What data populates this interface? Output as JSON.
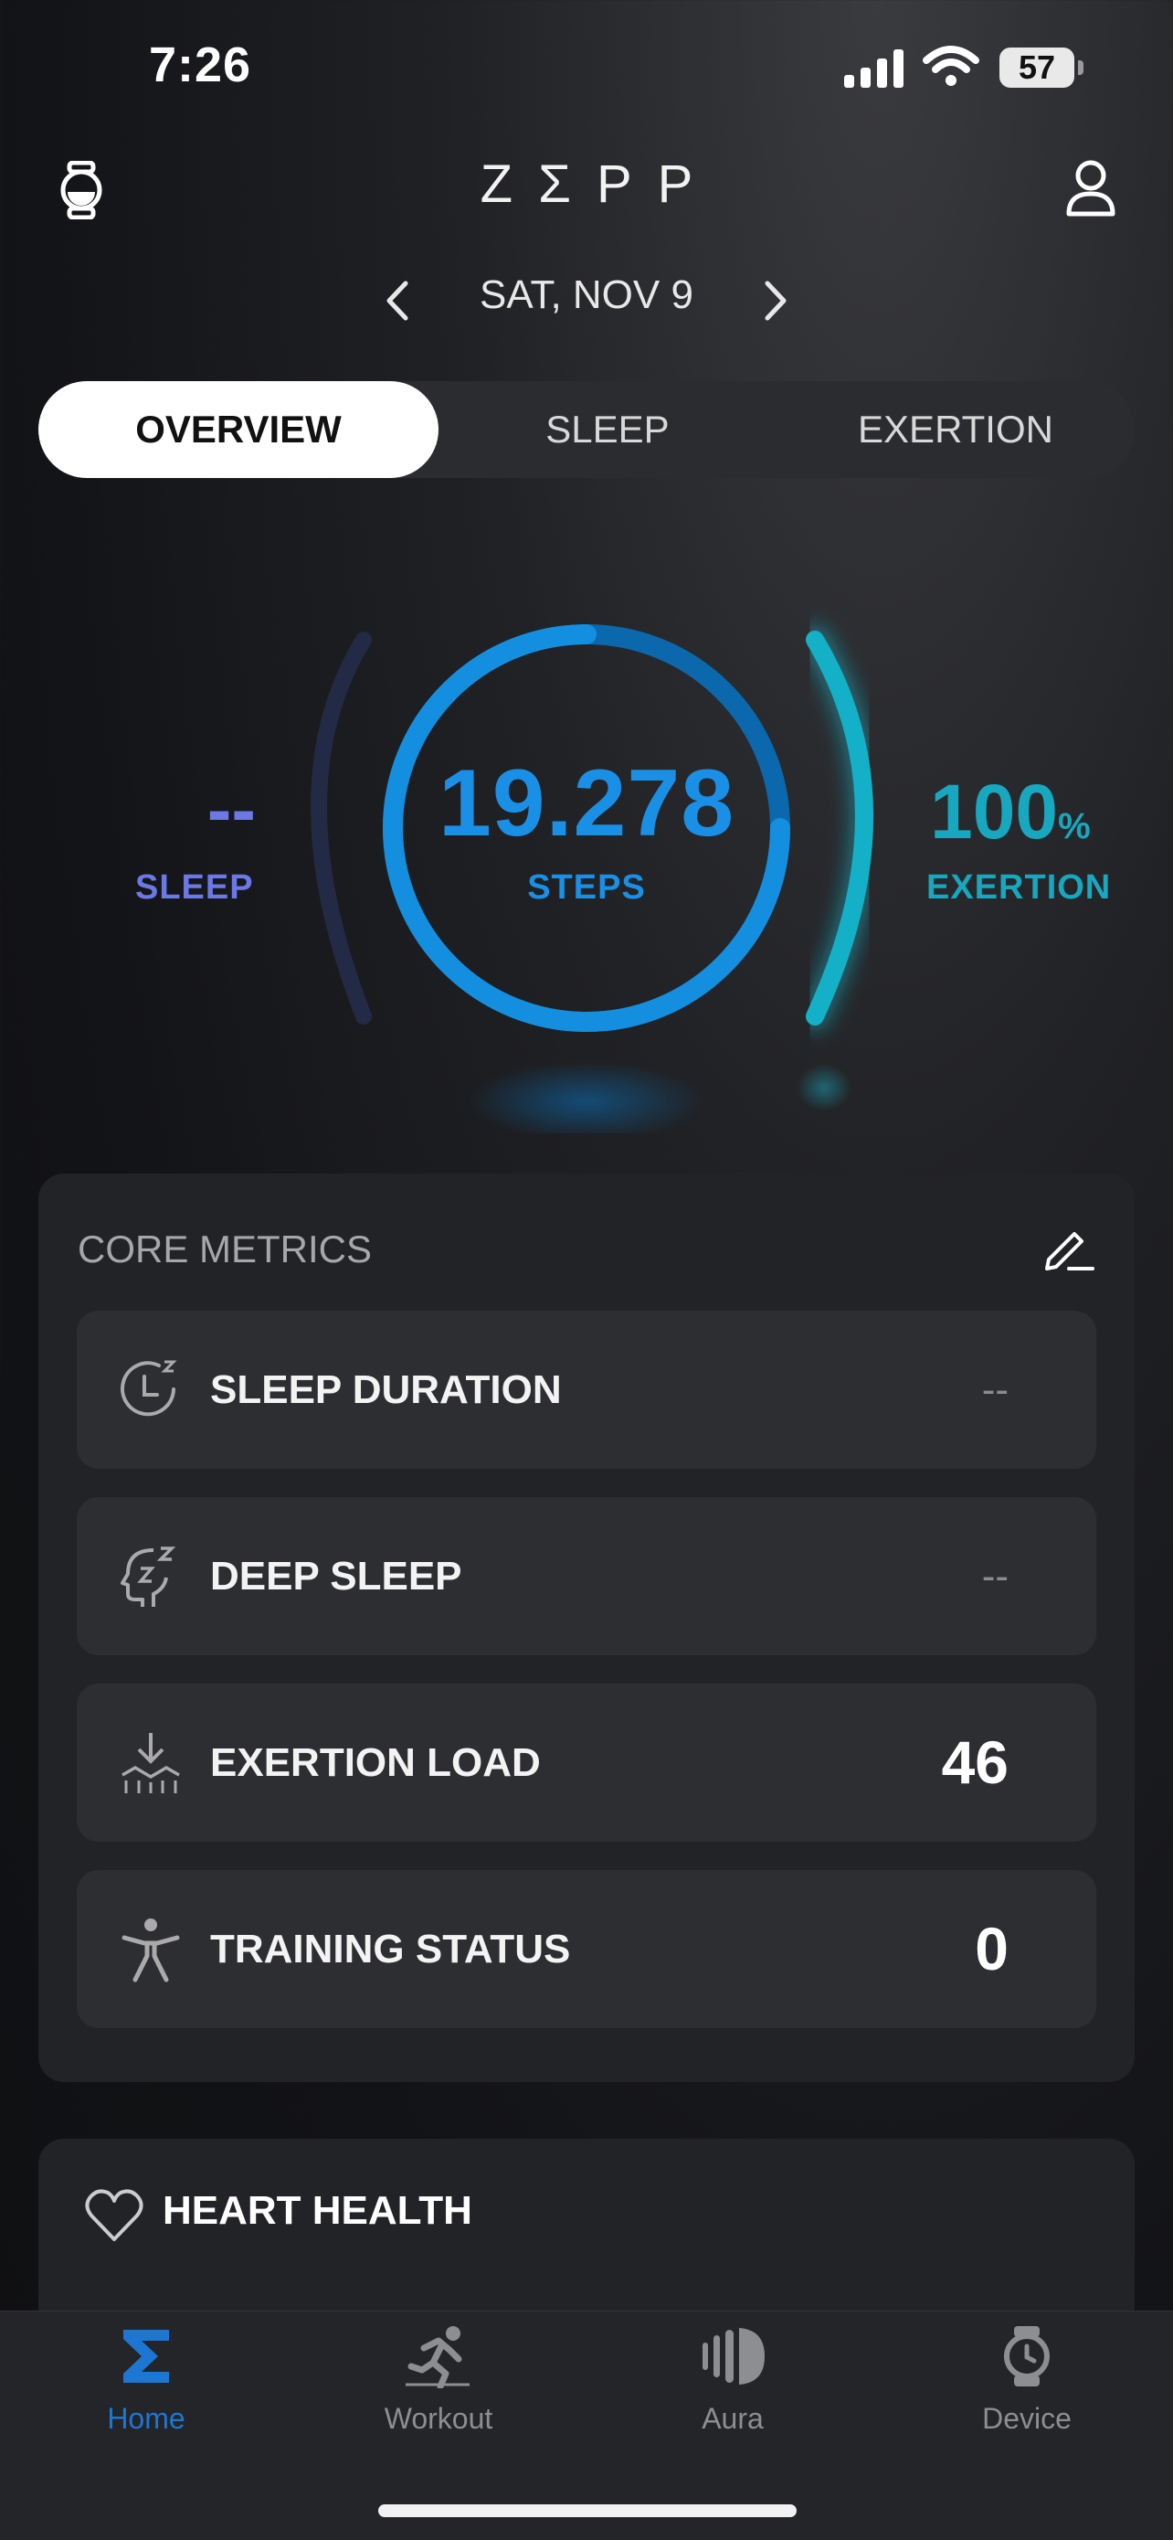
{
  "status_bar": {
    "time": "7:26",
    "battery": "57"
  },
  "header": {
    "brand": "ZΣPP",
    "date": "SAT, NOV 9"
  },
  "tabs": [
    {
      "label": "OVERVIEW",
      "active": true
    },
    {
      "label": "SLEEP",
      "active": false
    },
    {
      "label": "EXERTION",
      "active": false
    }
  ],
  "summary": {
    "sleep": {
      "value": "--",
      "label": "SLEEP"
    },
    "steps": {
      "value": "19.278",
      "label": "STEPS"
    },
    "exertion": {
      "value": "100",
      "unit": "%",
      "label": "EXERTION",
      "level": 1.0
    }
  },
  "core_metrics": {
    "title": "CORE METRICS",
    "items": [
      {
        "label": "SLEEP DURATION",
        "value": "--",
        "icon": "sleep-clock-icon"
      },
      {
        "label": "DEEP SLEEP",
        "value": "--",
        "icon": "deep-sleep-head-icon"
      },
      {
        "label": "EXERTION LOAD",
        "value": "46",
        "icon": "exertion-load-icon"
      },
      {
        "label": "TRAINING STATUS",
        "value": "0",
        "icon": "training-person-icon"
      }
    ]
  },
  "heart_health": {
    "title": "HEART HEALTH"
  },
  "nav": [
    {
      "label": "Home",
      "icon": "sigma-home-icon",
      "active": true
    },
    {
      "label": "Workout",
      "icon": "runner-icon",
      "active": false
    },
    {
      "label": "Aura",
      "icon": "aura-icon",
      "active": false
    },
    {
      "label": "Device",
      "icon": "watch-icon",
      "active": false
    }
  ],
  "colors": {
    "sleep": "#6b79e6",
    "steps": "#1a8fe6",
    "exertion": "#17a7bf",
    "nav_active": "#1e76d3"
  }
}
